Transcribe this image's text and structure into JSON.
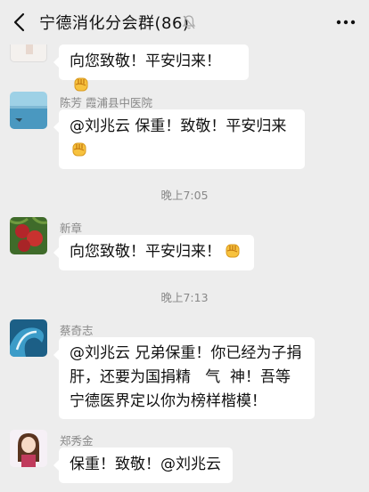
{
  "header": {
    "title": "宁德消化分会群(86)",
    "back_icon": "chevron-left-icon",
    "mute_icon": "bell-off-icon",
    "more_icon": "more-dots-icon"
  },
  "messages": [
    {
      "sender": "",
      "text": "向您致敬！平安归来！",
      "emoji": "raised-fist"
    },
    {
      "sender": "陈芳 霞浦县中医院",
      "text": "@刘兆云  保重！致敬！平安归来",
      "emoji": "raised-fist"
    },
    {
      "sender": "新章",
      "text": "向您致敬！平安归来！",
      "emoji": "raised-fist"
    },
    {
      "sender": "蔡奇志",
      "lines": [
        "@刘兆云  兄弟保重！你已经为子捐",
        "肝，还要为国捐精   气  神！吾等",
        "宁德医界定以你为榜样楷模！"
      ]
    },
    {
      "sender": "郑秀金",
      "text": "保重！致敬！@刘兆云"
    }
  ],
  "timestamps": [
    "晚上7:05",
    "晚上7:13"
  ],
  "colors": {
    "background": "#ededed",
    "bubble": "#ffffff",
    "meta_text": "#888888"
  }
}
